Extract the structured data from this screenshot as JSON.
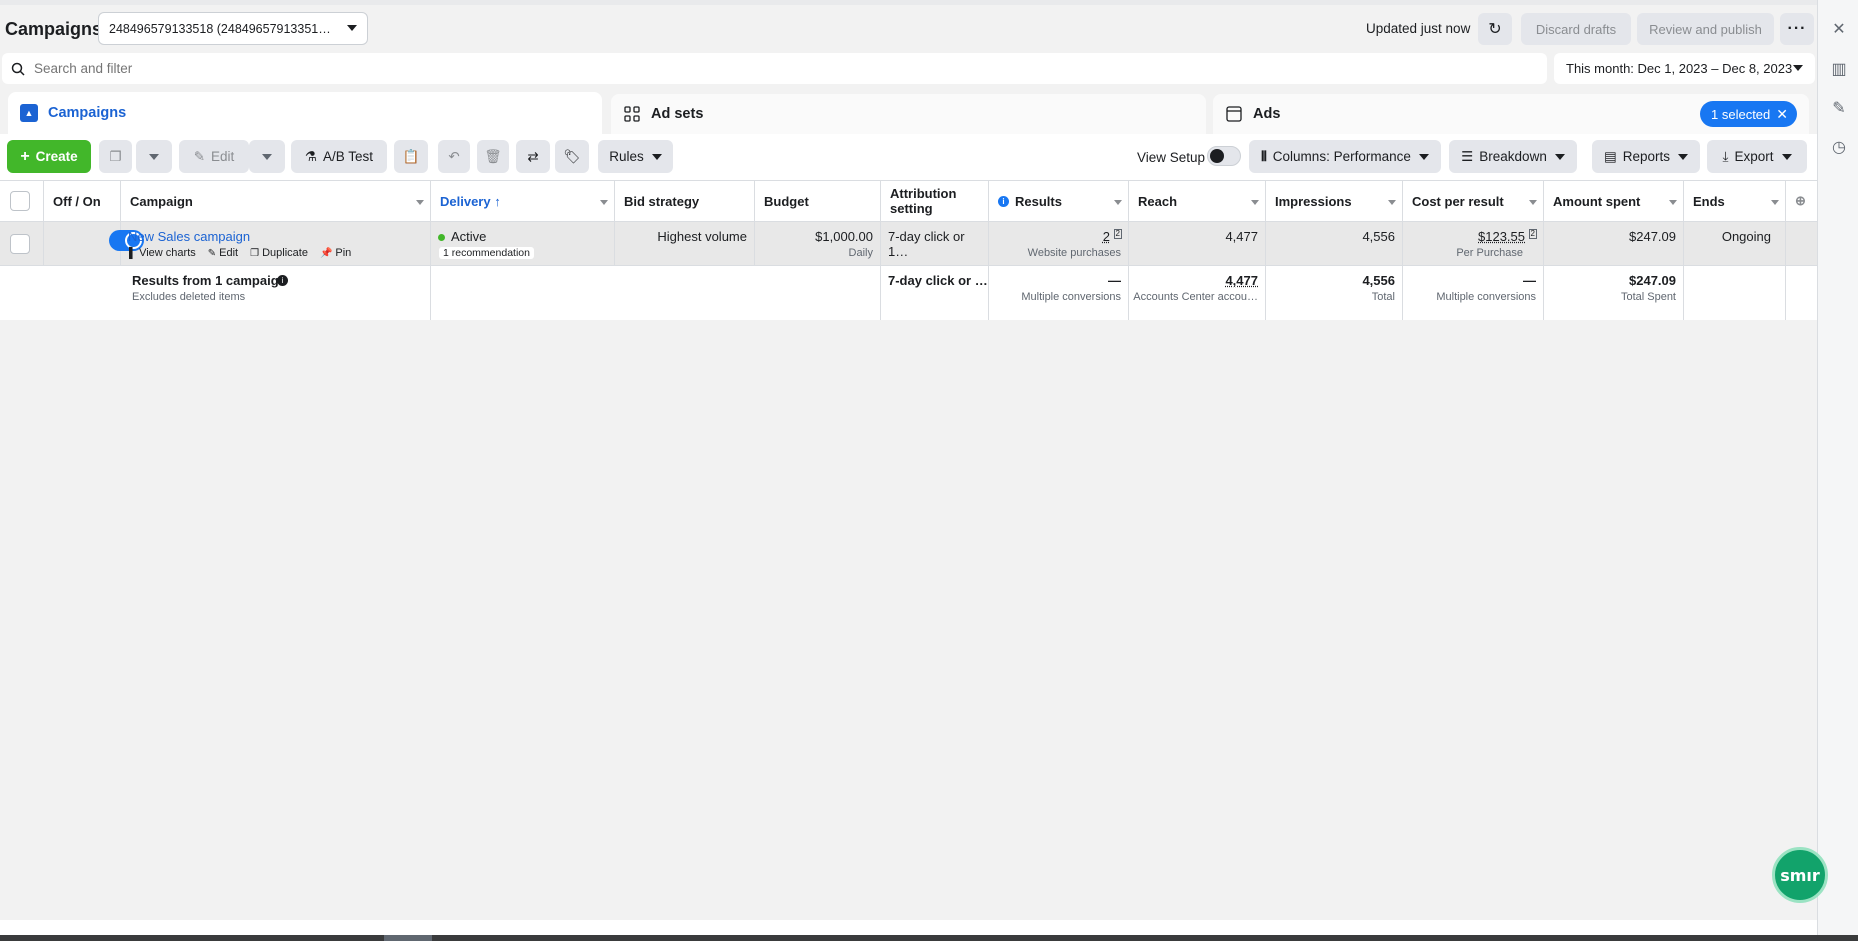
{
  "header": {
    "title": "Campaigns",
    "account": "248496579133518 (24849657913351…",
    "updated": "Updated just now",
    "discard_drafts": "Discard drafts",
    "review_publish": "Review and publish",
    "more": "···"
  },
  "search": {
    "placeholder": "Search and filter",
    "date_range": "This month: Dec 1, 2023 – Dec 8, 2023"
  },
  "tabs": {
    "campaigns": "Campaigns",
    "adsets": "Ad sets",
    "ads": "Ads",
    "selected": "1 selected"
  },
  "toolbar": {
    "create": "Create",
    "edit": "Edit",
    "ab_test": "A/B Test",
    "rules": "Rules",
    "view_setup": "View Setup",
    "columns": "Columns: Performance",
    "breakdown": "Breakdown",
    "reports": "Reports",
    "export": "Export"
  },
  "table": {
    "headers": {
      "off_on": "Off / On",
      "campaign": "Campaign",
      "delivery": "Delivery ↑",
      "bid_strategy": "Bid strategy",
      "budget": "Budget",
      "attribution": "Attribution setting",
      "results": "Results",
      "reach": "Reach",
      "impressions": "Impressions",
      "cost_per_result": "Cost per result",
      "amount_spent": "Amount spent",
      "ends": "Ends"
    },
    "row": {
      "name": "New Sales campaign",
      "view_charts": "View charts",
      "edit": "Edit",
      "duplicate": "Duplicate",
      "pin": "Pin",
      "delivery": "Active",
      "recommendation": "1 recommendation",
      "bid_strategy": "Highest volume",
      "budget": "$1,000.00",
      "budget_sub": "Daily",
      "attribution": "7-day click or 1…",
      "results": "2",
      "results_sub": "Website purchases",
      "reach": "4,477",
      "impressions": "4,556",
      "cost_per_result": "$123.55",
      "cost_sub": "Per Purchase",
      "amount_spent": "$247.09",
      "ends": "Ongoing"
    },
    "summary": {
      "label": "Results from 1 campaign",
      "sub": "Excludes deleted items",
      "attribution": "7-day click or …",
      "results": "—",
      "results_sub": "Multiple conversions",
      "reach": "4,477",
      "reach_sub": "Accounts Center accou…",
      "impressions": "4,556",
      "impressions_sub": "Total",
      "cost": "—",
      "cost_sub": "Multiple conversions",
      "amount_spent": "$247.09",
      "amount_sub": "Total Spent"
    }
  },
  "fab": {
    "label": "smır"
  },
  "colors": {
    "accent": "#1877f2",
    "create_green": "#42b72a",
    "active_dot": "#42b72a"
  }
}
